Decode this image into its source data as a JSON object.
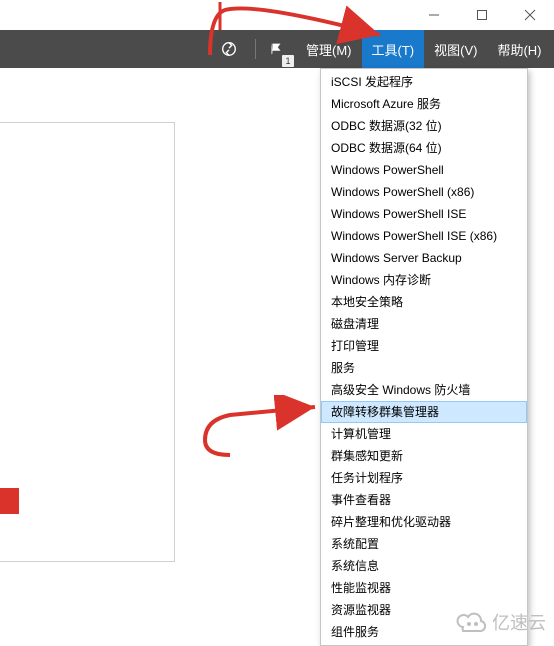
{
  "window": {
    "minimize_title": "Minimize",
    "maximize_title": "Maximize",
    "close_title": "Close"
  },
  "menubar": {
    "notification_count": "1",
    "items": {
      "manage": "管理(M)",
      "tools": "工具(T)",
      "view": "视图(V)",
      "help": "帮助(H)"
    }
  },
  "tools_menu": {
    "items": [
      "iSCSI 发起程序",
      "Microsoft Azure 服务",
      "ODBC 数据源(32 位)",
      "ODBC 数据源(64 位)",
      "Windows PowerShell",
      "Windows PowerShell (x86)",
      "Windows PowerShell ISE",
      "Windows PowerShell ISE (x86)",
      "Windows Server Backup",
      "Windows 内存诊断",
      "本地安全策略",
      "磁盘清理",
      "打印管理",
      "服务",
      "高级安全 Windows 防火墙",
      "故障转移群集管理器",
      "计算机管理",
      "群集感知更新",
      "任务计划程序",
      "事件查看器",
      "碎片整理和优化驱动器",
      "系统配置",
      "系统信息",
      "性能监视器",
      "资源监视器",
      "组件服务"
    ],
    "selected_index": 15
  },
  "watermark": {
    "text": "亿速云"
  }
}
